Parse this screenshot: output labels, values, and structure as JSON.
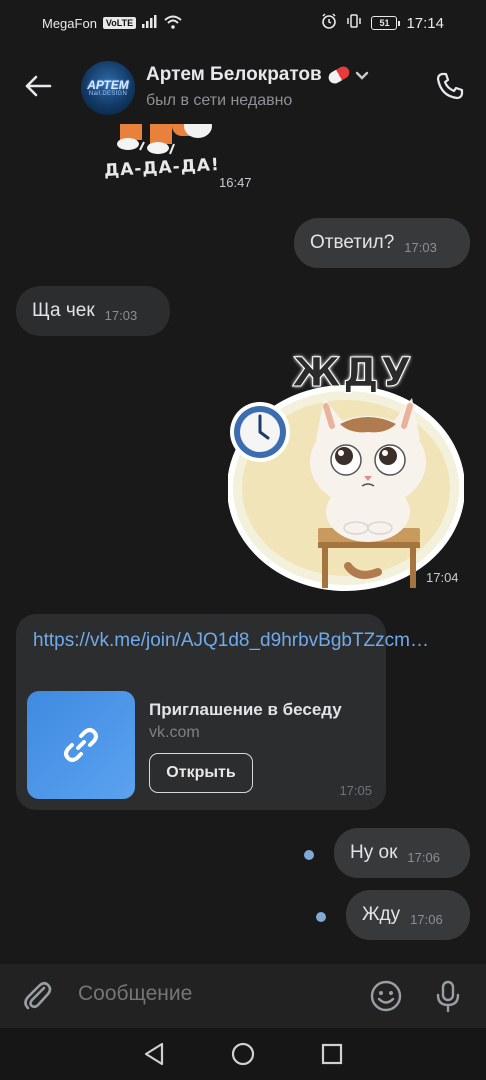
{
  "status_bar": {
    "carrier": "MegaFon",
    "volte": "VoLTE",
    "battery": "51",
    "time": "17:14"
  },
  "header": {
    "name": "Артем Белократов",
    "status": "был в сети недавно",
    "avatar_text": "АРТЕМ",
    "avatar_sub": "Nail.DESIGN"
  },
  "messages": {
    "sticker1_time": "16:47",
    "msg1_text": "Ответил?",
    "msg1_time": "17:03",
    "msg2_text": "Ща чек",
    "msg2_time": "17:03",
    "sticker2_caption": "ЖДУ",
    "sticker2_time": "17:04",
    "sticker1_caption": "ДА-ДА-ДА!",
    "link": {
      "url": "https://vk.me/join/AJQ1d8_d9hrbvBgbTZzcm…",
      "title": "Приглашение в беседу",
      "domain": "vk.com",
      "button": "Открыть",
      "time": "17:05"
    },
    "msg3_text": "Ну ок",
    "msg3_time": "17:06",
    "msg4_text": "Жду",
    "msg4_time": "17:06"
  },
  "composer": {
    "placeholder": "Сообщение"
  },
  "colors": {
    "background": "#19191a",
    "bubble_in": "#2c2d2e",
    "bubble_out": "#38393b",
    "link": "#71aaeb",
    "unread_dot": "#82a8d6"
  },
  "icons": {
    "back": "arrow-left-icon",
    "call": "phone-icon",
    "attach": "paperclip-icon",
    "emoji": "smile-icon",
    "mic": "microphone-icon",
    "link_thumb": "chain-link-icon"
  }
}
